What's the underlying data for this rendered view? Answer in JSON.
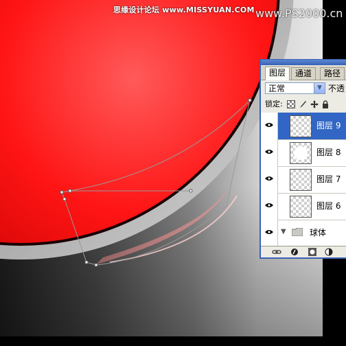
{
  "watermark": {
    "left_text": "思缘设计论坛 www.MISSYUAN.COM",
    "right_text": "www.PS2000.cn"
  },
  "layers_panel": {
    "tabs": [
      {
        "label": "图层",
        "active": true
      },
      {
        "label": "通道",
        "active": false
      },
      {
        "label": "路径",
        "active": false
      }
    ],
    "blend_mode": "正常",
    "opacity_label": "不透",
    "lock_label": "锁定:",
    "lock_icons": [
      "lock-transparency-icon",
      "lock-brush-icon",
      "lock-move-icon",
      "lock-all-icon"
    ],
    "layers": [
      {
        "name": "图层 9",
        "selected": true,
        "visible": true
      },
      {
        "name": "图层 8",
        "selected": false,
        "visible": true
      },
      {
        "name": "图层 7",
        "selected": false,
        "visible": true
      },
      {
        "name": "图层 6",
        "selected": false,
        "visible": true
      }
    ],
    "group": {
      "name": "球体",
      "expanded": false,
      "visible": true
    },
    "footer_icons": [
      "link-icon",
      "layer-style-icon",
      "mask-icon",
      "adjustment-icon"
    ]
  },
  "colors": {
    "button_red": "#ff1a1a",
    "panel_bg": "#ecebe4",
    "selection_blue": "#3166c4"
  }
}
